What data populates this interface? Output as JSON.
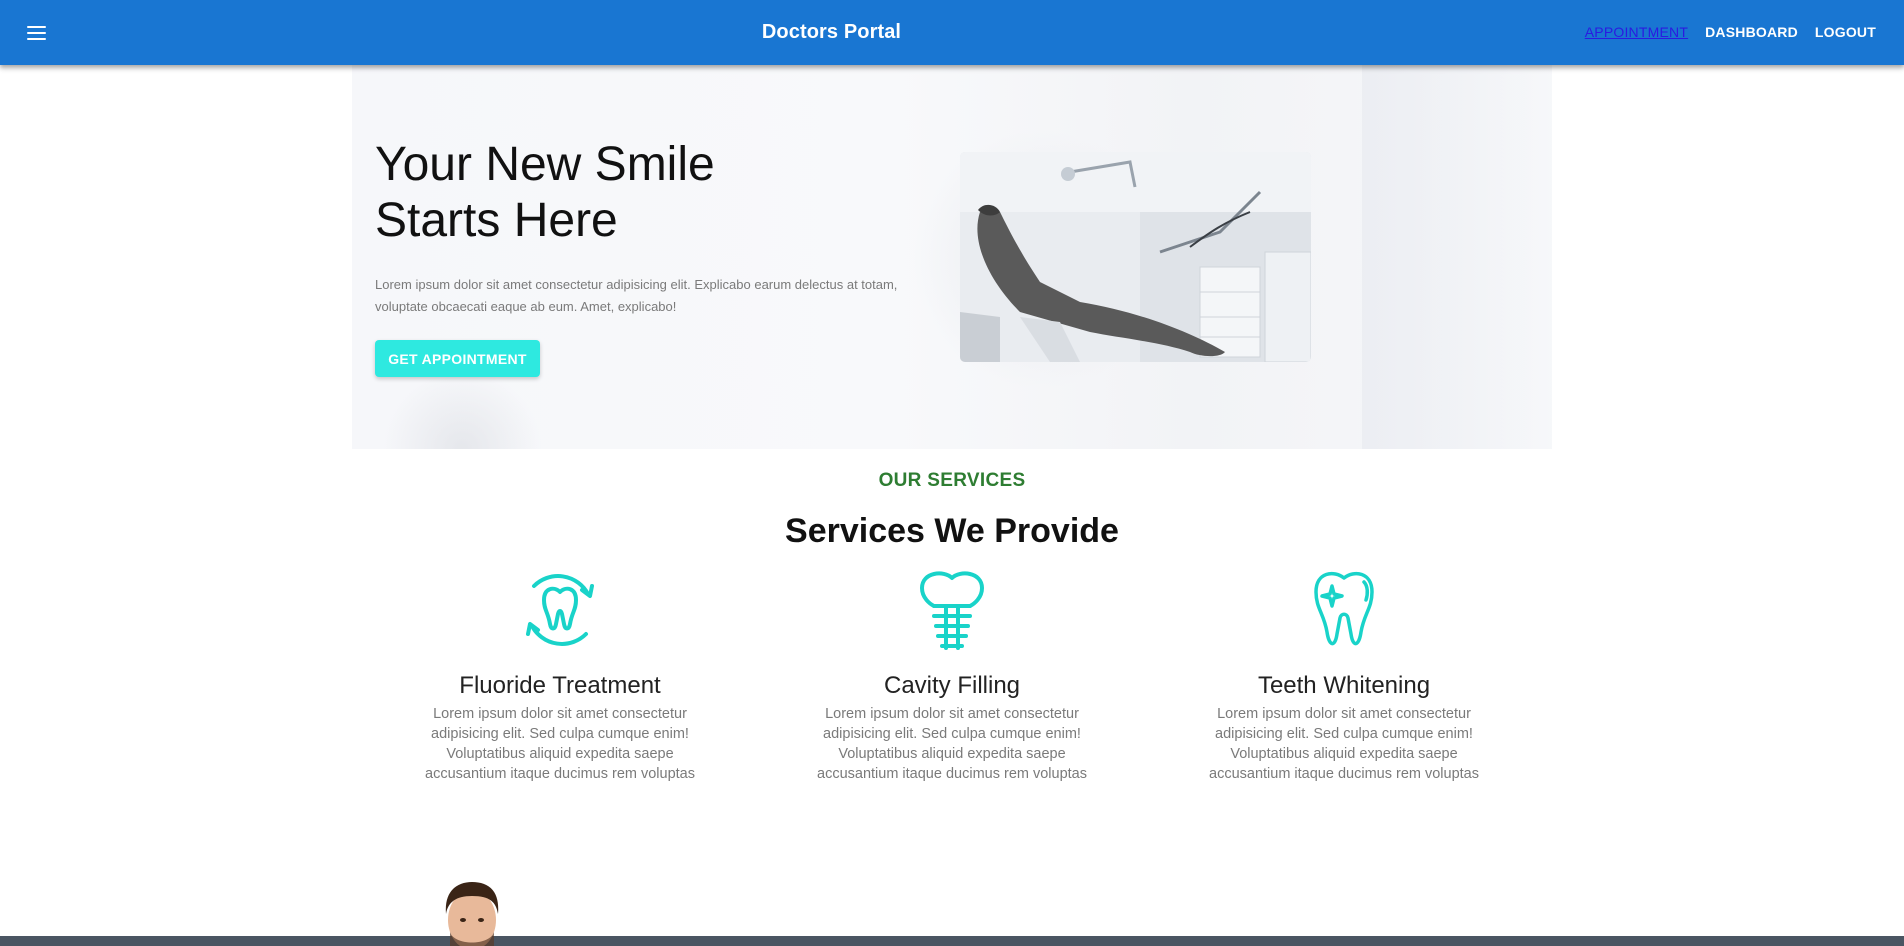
{
  "header": {
    "title": "Doctors Portal",
    "nav": [
      {
        "label": "APPOINTMENT",
        "active": true
      },
      {
        "label": "DASHBOARD",
        "active": false
      },
      {
        "label": "LOGOUT",
        "active": false
      }
    ]
  },
  "hero": {
    "title_line1": "Your New Smile",
    "title_line2": "Starts Here",
    "text": "Lorem ipsum dolor sit amet consectetur adipisicing elit. Explicabo earum delectus at totam, voluptate obcaecati eaque ab eum. Amet, explicabo!",
    "button": "GET APPOINTMENT"
  },
  "services": {
    "kicker": "OUR SERVICES",
    "title": "Services We Provide",
    "items": [
      {
        "name": "Fluoride Treatment",
        "description": "Lorem ipsum dolor sit amet consectetur adipisicing elit. Sed culpa cumque enim! Voluptatibus aliquid expedita saepe accusantium itaque ducimus rem voluptas",
        "icon": "tooth-cycle-icon"
      },
      {
        "name": "Cavity Filling",
        "description": "Lorem ipsum dolor sit amet consectetur adipisicing elit. Sed culpa cumque enim! Voluptatibus aliquid expedita saepe accusantium itaque ducimus rem voluptas",
        "icon": "tooth-implant-icon"
      },
      {
        "name": "Teeth Whitening",
        "description": "Lorem ipsum dolor sit amet consectetur adipisicing elit. Sed culpa cumque enim! Voluptatibus aliquid expedita saepe accusantium itaque ducimus rem voluptas",
        "icon": "tooth-sparkle-icon"
      }
    ]
  },
  "colors": {
    "appbar": "#1976d2",
    "accent": "#2ee9e0",
    "icon": "#19d3c9",
    "kicker": "#2e7d32"
  }
}
